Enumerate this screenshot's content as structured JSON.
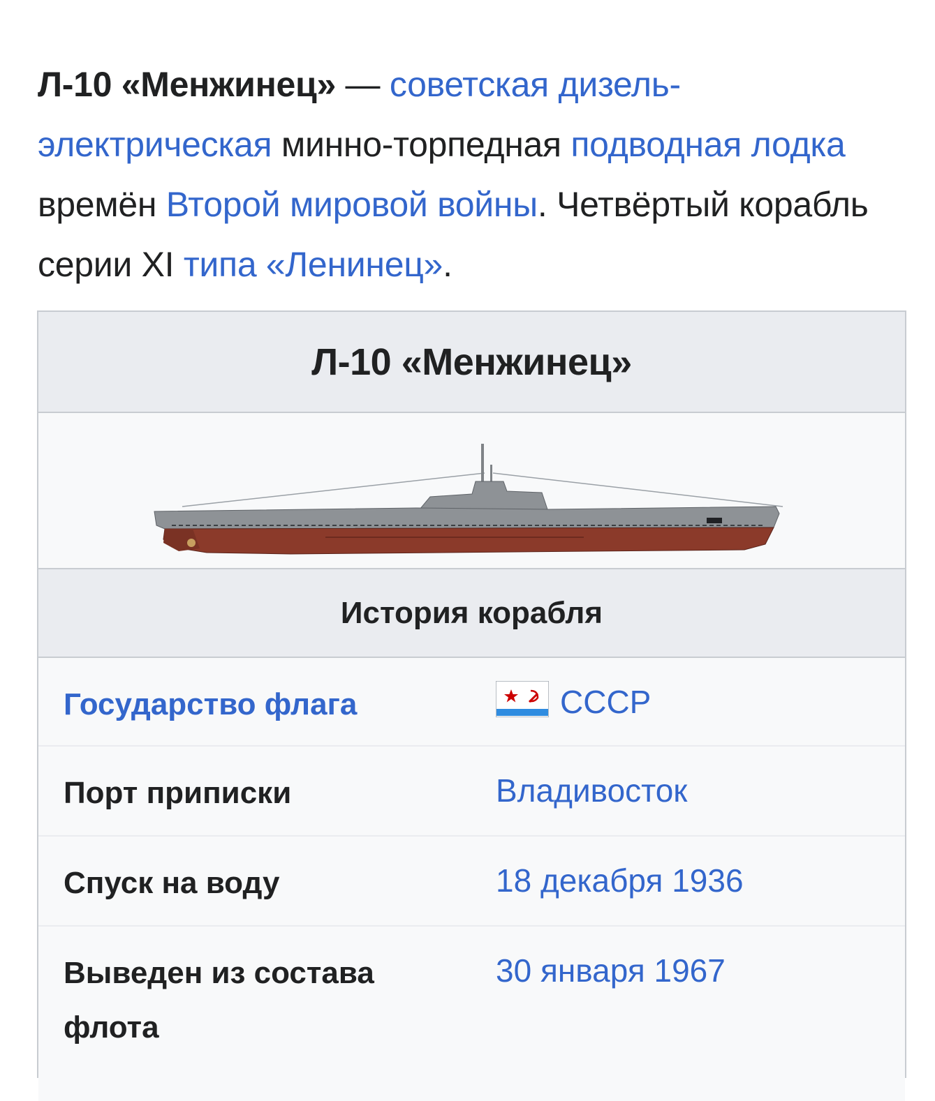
{
  "lead": {
    "title": "Л-10 «Менжинец»",
    "dash": " — ",
    "link_type": "советская дизель-электрическая",
    "t1": " минно-торпедная ",
    "link_sub": "подводная лодка",
    "t2": " времён ",
    "link_war": "Второй мировой войны",
    "t3": ". Четвёртый корабль серии XI ",
    "link_class": "типа «Ленинец»",
    "t4": "."
  },
  "infobox": {
    "title": "Л-10 «Менжинец»",
    "section": "История корабля",
    "rows": [
      {
        "label": "Государство флага",
        "value": "СССР"
      },
      {
        "label": "Порт приписки",
        "value": "Владивосток"
      },
      {
        "label": "Спуск на воду",
        "value": "18 декабря 1936"
      },
      {
        "label": "Выведен из состава флота",
        "value": "30 января 1967"
      }
    ]
  },
  "icons": {
    "flag": "ussr-naval-ensign-icon",
    "image": "submarine-profile"
  },
  "colors": {
    "link": "#3366cc",
    "header_bg": "#eaecf0",
    "body_bg": "#f8f9fa",
    "hull_red": "#8b3a2a",
    "hull_grey": "#8e9296"
  }
}
